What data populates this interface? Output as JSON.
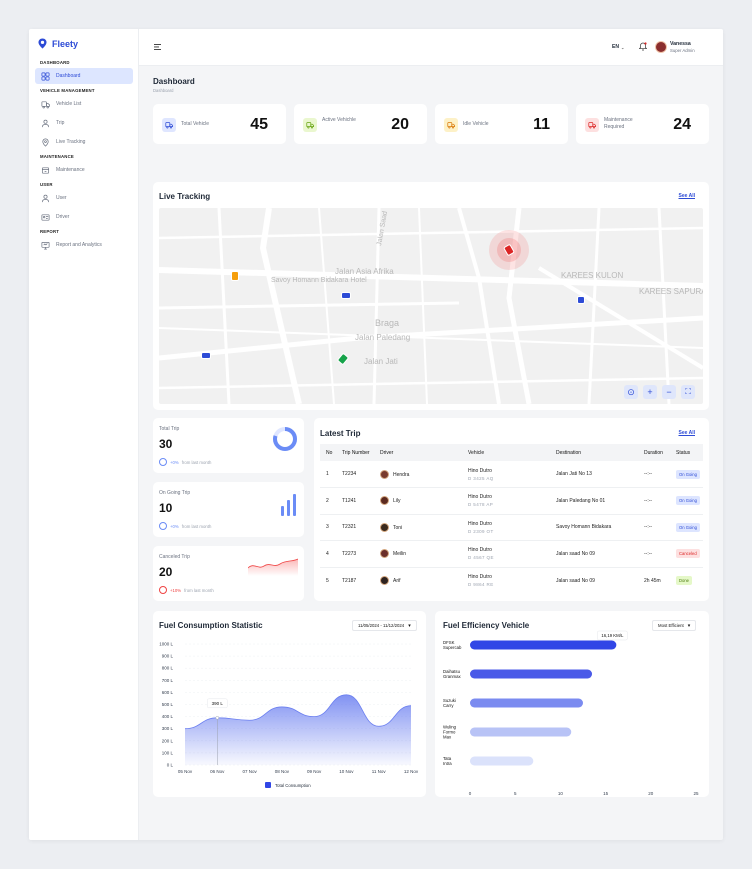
{
  "brand": {
    "name": "Fleety"
  },
  "sidebar": {
    "sections": [
      {
        "title": "DASHBOARD",
        "items": [
          {
            "label": "Dashboard",
            "icon": "grid-icon",
            "active": true
          }
        ]
      },
      {
        "title": "VEHICLE MANAGEMENT",
        "items": [
          {
            "label": "Vehicle List",
            "icon": "truck-icon"
          },
          {
            "label": "Trip",
            "icon": "route-icon"
          },
          {
            "label": "Live Tracking",
            "icon": "pin-icon"
          }
        ]
      },
      {
        "title": "MAINTENANCE",
        "items": [
          {
            "label": "Maintenance",
            "icon": "tools-icon"
          }
        ]
      },
      {
        "title": "USER",
        "items": [
          {
            "label": "User",
            "icon": "user-icon"
          },
          {
            "label": "Driver",
            "icon": "id-card-icon"
          }
        ]
      },
      {
        "title": "REPORT",
        "items": [
          {
            "label": "Report and Analytics",
            "icon": "monitor-icon"
          }
        ]
      }
    ]
  },
  "topbar": {
    "language": "EN",
    "user_name": "Vanessa",
    "user_role": "Super Admin"
  },
  "page": {
    "title": "Dashboard",
    "breadcrumb": "Dashboard"
  },
  "stats": [
    {
      "label": "Total Vehicle",
      "value": "45",
      "color": "#dfe6ff",
      "icon_color": "#2d4bd6"
    },
    {
      "label": "Active Vehichle",
      "value": "20",
      "color": "#eaf7cf",
      "icon_color": "#65a30d"
    },
    {
      "label": "Idle Vehicle",
      "value": "11",
      "color": "#fdf1c7",
      "icon_color": "#d97706"
    },
    {
      "label": "Maintenance Required",
      "value": "24",
      "color": "#fde0e0",
      "icon_color": "#dc2626"
    }
  ],
  "live_tracking": {
    "title": "Live Tracking",
    "see_all": "See All",
    "map_labels": [
      "Jalan Asia Afrika",
      "Savoy Homann Bidakara Hotel",
      "Braga",
      "Jalan Paledang",
      "Jalan Jati",
      "KAREES KULON",
      "KAREES SAPURAN",
      "Jalan Saad"
    ]
  },
  "mini_stats": [
    {
      "title": "Total Trip",
      "value": "30",
      "delta": "+0%",
      "suffix": " from last month"
    },
    {
      "title": "On Going Trip",
      "value": "10",
      "delta": "+0%",
      "suffix": " from last month"
    },
    {
      "title": "Canceled Trip",
      "value": "20",
      "delta": "+10%",
      "suffix": " from last month"
    }
  ],
  "latest_trip": {
    "title": "Latest Trip",
    "see_all": "See All",
    "columns": [
      "No",
      "Trip Number",
      "Driver",
      "Vehicle",
      "Destination",
      "Duration",
      "Status"
    ],
    "rows": [
      {
        "no": "1",
        "trip": "T2234",
        "driver": "Hendra",
        "vehicle": "Hino Dutro",
        "plate": "D 3425 AQ",
        "destination": "Jalan Jati No 13",
        "duration": "--:--",
        "status": "On Going"
      },
      {
        "no": "2",
        "trip": "T1241",
        "driver": "Lily",
        "vehicle": "Hino Dutro",
        "plate": "D 5478 AP",
        "destination": "Jalan Paledang No 01",
        "duration": "--:--",
        "status": "On Going"
      },
      {
        "no": "3",
        "trip": "T2321",
        "driver": "Toni",
        "vehicle": "Hino Dutro",
        "plate": "D 2309 OT",
        "destination": "Savoy Homann Bidakara",
        "duration": "--:--",
        "status": "On Going"
      },
      {
        "no": "4",
        "trip": "T2273",
        "driver": "Meilin",
        "vehicle": "Hino Dutro",
        "plate": "D 4567 QE",
        "destination": "Jalan saad No 09",
        "duration": "--:--",
        "status": "Canceled"
      },
      {
        "no": "5",
        "trip": "T2187",
        "driver": "Arif",
        "vehicle": "Hino Dutro",
        "plate": "D 9864 RE",
        "destination": "Jalan saad No 09",
        "duration": "2h 45m",
        "status": "Done"
      }
    ]
  },
  "fuel_consumption": {
    "title": "Fuel Consumption Statistic",
    "date_range": "11/05/2024 - 11/12/2024",
    "tooltip": "390 L",
    "legend": "Total Consumption"
  },
  "fuel_efficiency": {
    "title": "Fuel Efficiency Vehicle",
    "filter": "Most Efficient",
    "tooltip": "16,19 KM/L",
    "xlabel": "KM/L"
  },
  "chart_data": [
    {
      "type": "area",
      "title": "Fuel Consumption Statistic",
      "x": [
        "05 Nov",
        "06 Nov",
        "07 Nov",
        "08 Nov",
        "09 Nov",
        "10 Nov",
        "11 Nov",
        "12 Nov"
      ],
      "series": [
        {
          "name": "Total Consumption",
          "values": [
            300,
            390,
            370,
            480,
            400,
            580,
            320,
            490
          ]
        }
      ],
      "yticks": [
        "0 L",
        "100 L",
        "200 L",
        "300 L",
        "400 L",
        "500 L",
        "600 L",
        "700 L",
        "800 L",
        "900 L",
        "1000 L"
      ],
      "ylim": [
        0,
        1000
      ],
      "color": "#6b7ff0"
    },
    {
      "type": "bar",
      "title": "Fuel Efficiency Vehicle",
      "orientation": "horizontal",
      "categories": [
        "DFSK Supercab",
        "Daihatsu Granmax",
        "Suzuki Carry",
        "Wuling Formo Max",
        "Tata Intra"
      ],
      "values": [
        16.19,
        13.5,
        12.5,
        11.2,
        7.0
      ],
      "xticks": [
        "0",
        "5",
        "10",
        "15",
        "20",
        "25"
      ],
      "xlim": [
        0,
        25
      ],
      "xlabel": "KM/L",
      "colors": [
        "#3146e6",
        "#4a5ae8",
        "#7b8bf0",
        "#b8c3f6",
        "#dbe2fb"
      ]
    }
  ]
}
